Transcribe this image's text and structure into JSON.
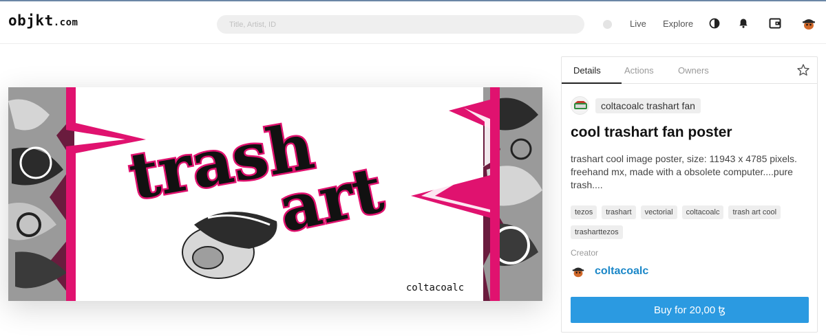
{
  "header": {
    "logo_main": "objkt",
    "logo_suffix": ".com",
    "search_placeholder": "Title, Artist, ID",
    "nav": {
      "live": "Live",
      "explore": "Explore"
    }
  },
  "panel": {
    "tabs": [
      "Details",
      "Actions",
      "Owners"
    ],
    "owner_chip": "coltacoalc trashart fan",
    "title": "cool trashart fan poster",
    "description": "trashart cool image poster, size: 11943 x 4785 pixels. freehand mx, made with a obsolete computer....pure trash....",
    "tags": [
      "tezos",
      "trashart",
      "vectorial",
      "coltacoalc",
      "trash art cool",
      "trasharttezos"
    ],
    "creator_label": "Creator",
    "creator_name": "coltacoalc",
    "buy_label": "Buy for 20,00 ꜩ"
  },
  "artwork": {
    "text_line1": "trash",
    "text_line2": "art",
    "signature": "coltacoalc"
  },
  "colors": {
    "accent_blue": "#2b9ae1",
    "creator_link": "#1b87c8",
    "art_magenta": "#e0126f",
    "art_maroon": "#5c1634"
  },
  "icons": [
    "status-dot-icon",
    "theme-toggle-icon",
    "bell-icon",
    "wallet-icon",
    "avatar-icon",
    "star-icon"
  ]
}
